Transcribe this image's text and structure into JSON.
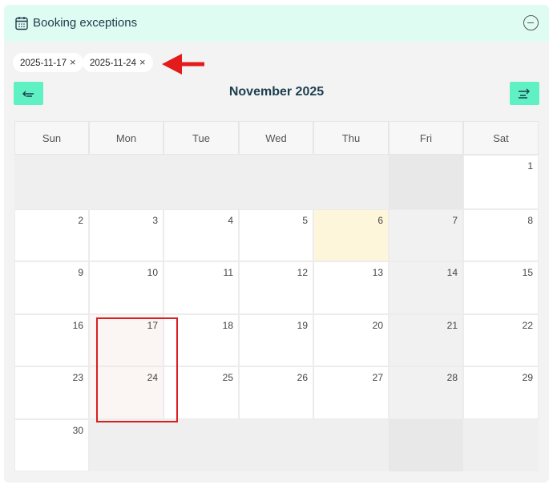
{
  "header": {
    "title": "Booking exceptions"
  },
  "chips": [
    {
      "label": "2025-11-17",
      "remove": "×"
    },
    {
      "label": "2025-11-24",
      "remove": "×"
    }
  ],
  "calendar": {
    "month": "November 2025",
    "weekdays": [
      "Sun",
      "Mon",
      "Tue",
      "Wed",
      "Thu",
      "Fri",
      "Sat"
    ],
    "weeks": [
      [
        "",
        "",
        "",
        "",
        "",
        "",
        "1"
      ],
      [
        "2",
        "3",
        "4",
        "5",
        "6",
        "7",
        "8"
      ],
      [
        "9",
        "10",
        "11",
        "12",
        "13",
        "14",
        "15"
      ],
      [
        "16",
        "17",
        "18",
        "19",
        "20",
        "21",
        "22"
      ],
      [
        "23",
        "24",
        "25",
        "26",
        "27",
        "28",
        "29"
      ],
      [
        "30",
        "",
        "",
        "",
        "",
        "",
        ""
      ]
    ],
    "today": "6",
    "selected_dates": [
      "17",
      "24"
    ]
  },
  "colors": {
    "header_bg": "#dffcf3",
    "nav_button": "#5ff1c4",
    "today_bg": "#fef6db",
    "selected_bg": "#fbf5f4",
    "highlight_border": "#d91f1f",
    "annotation_arrow": "#e31b1b"
  },
  "icons": {
    "header": "calendar-icon",
    "collapse": "minus-circle-icon",
    "prev": "arrow-left-icon",
    "next": "arrow-right-icon",
    "annotation": "red-arrow-icon"
  }
}
